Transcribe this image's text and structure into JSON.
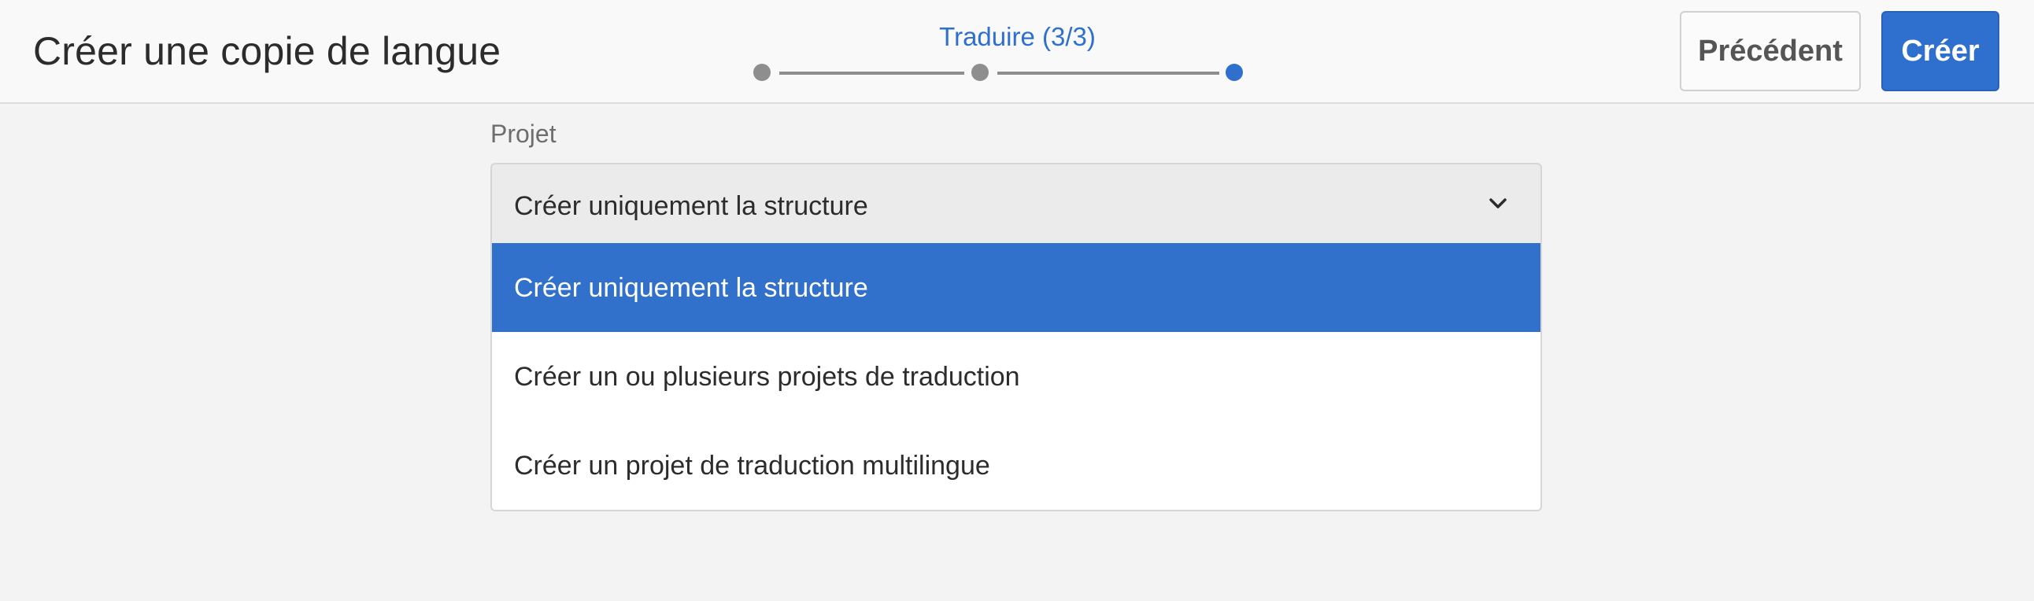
{
  "header": {
    "title": "Créer une copie de langue",
    "step_label": "Traduire (3/3)",
    "steps": [
      "completed",
      "completed",
      "active"
    ],
    "back_button": "Précédent",
    "create_button": "Créer"
  },
  "form": {
    "project_label": "Projet",
    "selected_value": "Créer uniquement la structure",
    "options": [
      {
        "label": "Créer uniquement la structure",
        "selected": true
      },
      {
        "label": "Créer un ou plusieurs projets de traduction",
        "selected": false
      },
      {
        "label": "Créer un projet de traduction multilingue",
        "selected": false
      }
    ]
  },
  "colors": {
    "accent": "#2f6fcd",
    "step_inactive": "#8e8e8e",
    "background": "#f3f3f3"
  },
  "icons": {
    "dropdown": "chevron-down-icon"
  }
}
